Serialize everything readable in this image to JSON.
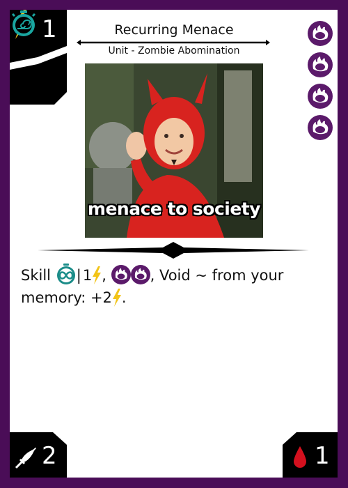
{
  "card": {
    "title": "Recurring Menace",
    "type_line": "Unit - Zombie Abomination",
    "cost": "1",
    "art_caption": "menace to society",
    "rules_line1_prefix": "Skill",
    "rules_sep": "|",
    "rules_cost_num": "1",
    "rules_comma1": ",",
    "rules_after_pips": ", Void ~ from your",
    "rules_line2": "memory: +2",
    "rules_period": ".",
    "power": "2",
    "health": "1",
    "pip_icon": "void-flame-icon",
    "colors": {
      "frame": "#4a0d57",
      "pip": "#5b1a6a",
      "energy": "#f2c418",
      "speed": "#1aa6a0",
      "blood": "#d4101e"
    }
  }
}
